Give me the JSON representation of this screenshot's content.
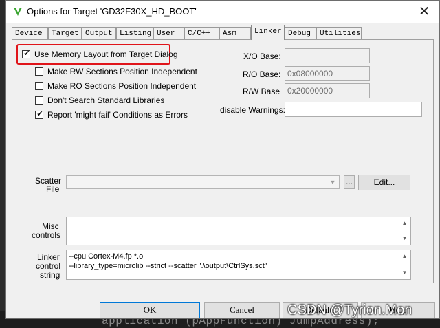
{
  "window": {
    "title": "Options for Target 'GD32F30X_HD_BOOT'",
    "close_glyph": "✕"
  },
  "tabs": [
    {
      "label": "Device"
    },
    {
      "label": "Target"
    },
    {
      "label": "Output"
    },
    {
      "label": "Listing"
    },
    {
      "label": "User"
    },
    {
      "label": "C/C++"
    },
    {
      "label": "Asm"
    },
    {
      "label": "Linker",
      "active": true
    },
    {
      "label": "Debug"
    },
    {
      "label": "Utilities"
    }
  ],
  "options": {
    "use_memory_layout": {
      "label": "Use Memory Layout from Target Dialog",
      "checked": true
    },
    "make_rw": {
      "label": "Make RW Sections Position Independent",
      "checked": false
    },
    "make_ro": {
      "label": "Make RO Sections Position Independent",
      "checked": false
    },
    "dont_search": {
      "label": "Don't Search Standard Libraries",
      "checked": false
    },
    "might_fail": {
      "label": "Report 'might fail' Conditions as Errors",
      "checked": true
    }
  },
  "fields": {
    "xo_base": {
      "label": "X/O Base:",
      "value": ""
    },
    "ro_base": {
      "label": "R/O Base:",
      "value": "0x08000000"
    },
    "rw_base": {
      "label": "R/W Base",
      "value": "0x20000000"
    },
    "disable_warnings": {
      "label": "disable Warnings:",
      "value": ""
    }
  },
  "scatter": {
    "label_line1": "Scatter",
    "label_line2": "File",
    "value": "",
    "browse_label": "...",
    "edit_label": "Edit..."
  },
  "misc": {
    "label_line1": "Misc",
    "label_line2": "controls",
    "value": ""
  },
  "linker_control": {
    "label_line1": "Linker",
    "label_line2": "control",
    "label_line3": "string",
    "lines": [
      "--cpu Cortex-M4.fp *.o",
      "--library_type=microlib --strict --scatter \".\\output\\CtrlSys.sct\""
    ]
  },
  "buttons": {
    "ok": "OK",
    "cancel": "Cancel",
    "defaults": "Defaults",
    "help": "Help"
  },
  "background": {
    "code_text": "application  (pAppFunction) JumpAddress);"
  },
  "watermark": "CSDN @Tyrion.Mon",
  "colors": {
    "highlight": "#e0141a",
    "app_icon": "#3aa530"
  }
}
